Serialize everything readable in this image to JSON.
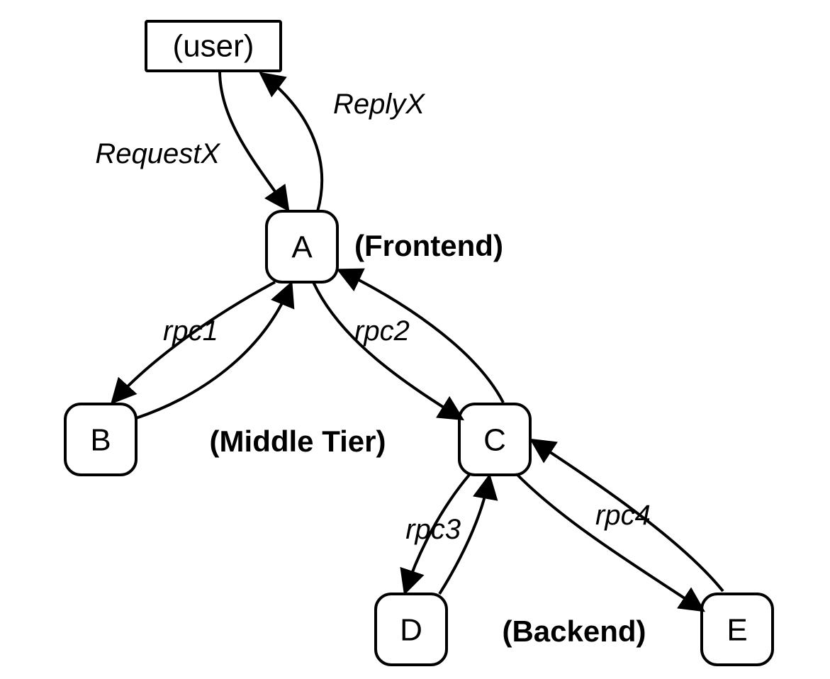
{
  "nodes": {
    "user": {
      "label": "(user)"
    },
    "A": {
      "label": "A"
    },
    "B": {
      "label": "B"
    },
    "C": {
      "label": "C"
    },
    "D": {
      "label": "D"
    },
    "E": {
      "label": "E"
    }
  },
  "tiers": {
    "frontend": {
      "label": "(Frontend)"
    },
    "middle": {
      "label": "(Middle Tier)"
    },
    "backend": {
      "label": "(Backend)"
    }
  },
  "edges": {
    "requestX": {
      "label": "RequestX"
    },
    "replyX": {
      "label": "ReplyX"
    },
    "rpc1": {
      "label": "rpc1"
    },
    "rpc2": {
      "label": "rpc2"
    },
    "rpc3": {
      "label": "rpc3"
    },
    "rpc4": {
      "label": "rpc4"
    }
  }
}
